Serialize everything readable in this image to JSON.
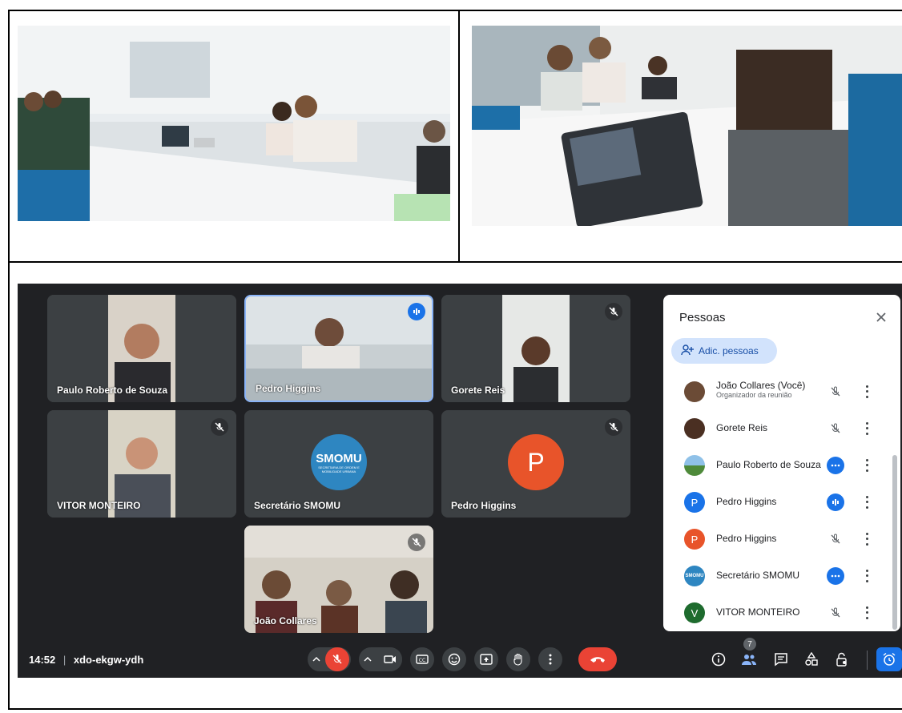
{
  "meet": {
    "tiles": [
      {
        "name": "Paulo Roberto de Souza"
      },
      {
        "name": "Pedro Higgins"
      },
      {
        "name": "Gorete Reis"
      },
      {
        "name": "VITOR MONTEIRO"
      },
      {
        "name": "Secretário SMOMU"
      },
      {
        "name": "Pedro Higgins"
      },
      {
        "name": "João Collares"
      }
    ],
    "smomu_logo": {
      "text": "SMOMU",
      "subtext": "SECRETARIA DE ORDEM E MOBILIDADE URBANA"
    },
    "avatar_letter": "P",
    "clock": "14:52",
    "separator": "|",
    "meeting_code": "xdo-ekgw-ydh",
    "participant_count": "7"
  },
  "panel": {
    "title": "Pessoas",
    "add_label": "Adic. pessoas",
    "participants": [
      {
        "name": "João Collares (Você)",
        "subtitle": "Organizador da reunião",
        "avatar": "photo",
        "status": "muted"
      },
      {
        "name": "Gorete Reis",
        "subtitle": "",
        "avatar": "photo",
        "status": "muted"
      },
      {
        "name": "Paulo Roberto de Souza",
        "subtitle": "",
        "avatar": "photo",
        "status": "more"
      },
      {
        "name": "Pedro Higgins",
        "subtitle": "",
        "avatar": "P",
        "status": "speaking"
      },
      {
        "name": "Pedro Higgins",
        "subtitle": "",
        "avatar": "P",
        "status": "muted"
      },
      {
        "name": "Secretário SMOMU",
        "subtitle": "",
        "avatar": "logo",
        "status": "more"
      },
      {
        "name": "VITOR MONTEIRO",
        "subtitle": "",
        "avatar": "V",
        "status": "muted"
      }
    ]
  },
  "colors": {
    "accent": "#1a73e8",
    "danger": "#ea4335",
    "meet_bg": "#202124",
    "tile_bg": "#3c4043",
    "smomu_blue": "#2e86c1",
    "avatar_p_blue": "#1a73e8",
    "avatar_p_orange": "#e8542a",
    "avatar_v_green": "#1e6b2e"
  }
}
